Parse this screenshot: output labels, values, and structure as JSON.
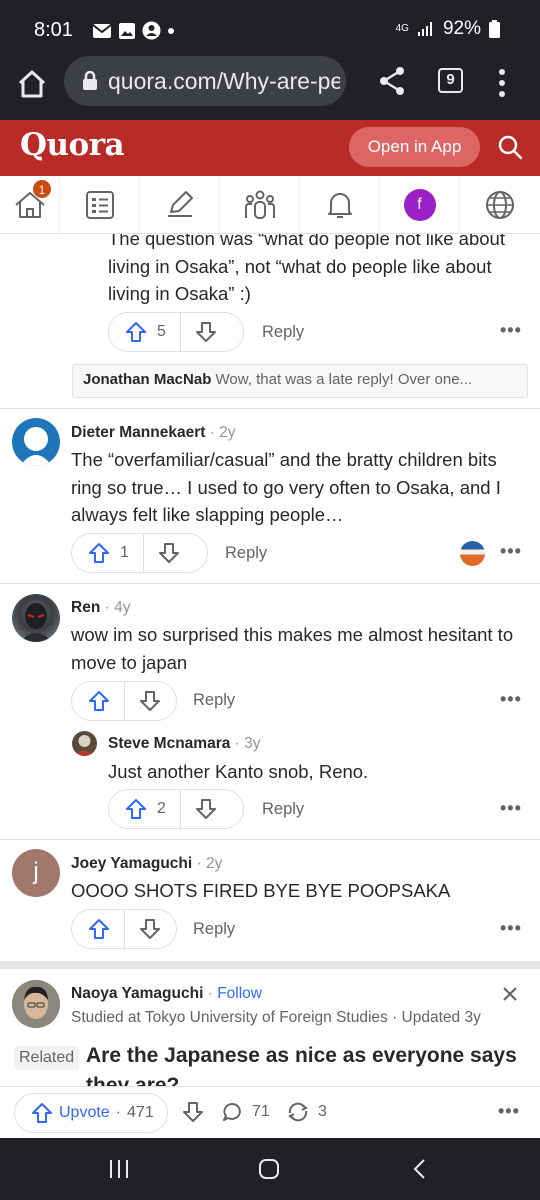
{
  "status_bar": {
    "time": "8:01",
    "network": "4G",
    "battery": "92%"
  },
  "browser": {
    "url": "quora.com/Why-are-pe",
    "tab_count": "9"
  },
  "header": {
    "logo": "Quora",
    "open_in_app": "Open in App"
  },
  "nav": {
    "home_badge": "1",
    "profile_initial": "f"
  },
  "comments": {
    "partial": {
      "text": "The question was “what do people not like about living in Osaka”, not “what do people like about living in Osaka” :)",
      "upvotes": "5",
      "reply": "Reply",
      "quote_author": "Jonathan MacNab",
      "quote_text": "Wow, that was a late reply! Over one..."
    },
    "dieter": {
      "author": "Dieter Mannekaert",
      "ago": " · 2y",
      "text": "The “overfamiliar/casual” and the bratty children bits ring so true… I used to go very often to Osaka, and I always felt like slapping people…",
      "upvotes": "1",
      "reply": "Reply"
    },
    "ren": {
      "author": "Ren",
      "ago": " · 4y",
      "text": "wow im so surprised this makes me almost hesitant to move to japan",
      "reply": "Reply"
    },
    "steve": {
      "author": "Steve Mcnamara",
      "ago": " · 3y",
      "text": "Just another Kanto snob, Reno.",
      "upvotes": "2",
      "reply": "Reply"
    },
    "joey": {
      "author": "Joey Yamaguchi",
      "ago": " · 2y",
      "initial": "j",
      "text": "OOOO SHOTS FIRED BYE BYE POOPSAKA",
      "reply": "Reply"
    }
  },
  "related_answer": {
    "author": "Naoya Yamaguchi",
    "follow": "Follow",
    "credential": "Studied at Tokyo University of Foreign Studies · Updated 3y",
    "related_label": "Related",
    "title": "Are the Japanese as nice as everyone says they are?"
  },
  "action_bar": {
    "upvote_label": "Upvote",
    "upvote_count": "471",
    "comments": "71",
    "shares": "3"
  },
  "colors": {
    "quora_red": "#b92b27",
    "link_blue": "#2e69ff",
    "muted": "#636466"
  }
}
